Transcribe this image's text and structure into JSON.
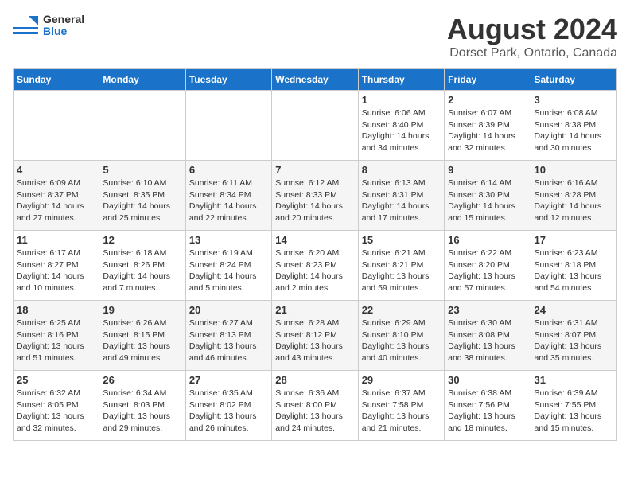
{
  "logo": {
    "line1": "General",
    "line2": "Blue"
  },
  "title": "August 2024",
  "location": "Dorset Park, Ontario, Canada",
  "days_of_week": [
    "Sunday",
    "Monday",
    "Tuesday",
    "Wednesday",
    "Thursday",
    "Friday",
    "Saturday"
  ],
  "weeks": [
    [
      {
        "day": "",
        "info": ""
      },
      {
        "day": "",
        "info": ""
      },
      {
        "day": "",
        "info": ""
      },
      {
        "day": "",
        "info": ""
      },
      {
        "day": "1",
        "info": "Sunrise: 6:06 AM\nSunset: 8:40 PM\nDaylight: 14 hours\nand 34 minutes."
      },
      {
        "day": "2",
        "info": "Sunrise: 6:07 AM\nSunset: 8:39 PM\nDaylight: 14 hours\nand 32 minutes."
      },
      {
        "day": "3",
        "info": "Sunrise: 6:08 AM\nSunset: 8:38 PM\nDaylight: 14 hours\nand 30 minutes."
      }
    ],
    [
      {
        "day": "4",
        "info": "Sunrise: 6:09 AM\nSunset: 8:37 PM\nDaylight: 14 hours\nand 27 minutes."
      },
      {
        "day": "5",
        "info": "Sunrise: 6:10 AM\nSunset: 8:35 PM\nDaylight: 14 hours\nand 25 minutes."
      },
      {
        "day": "6",
        "info": "Sunrise: 6:11 AM\nSunset: 8:34 PM\nDaylight: 14 hours\nand 22 minutes."
      },
      {
        "day": "7",
        "info": "Sunrise: 6:12 AM\nSunset: 8:33 PM\nDaylight: 14 hours\nand 20 minutes."
      },
      {
        "day": "8",
        "info": "Sunrise: 6:13 AM\nSunset: 8:31 PM\nDaylight: 14 hours\nand 17 minutes."
      },
      {
        "day": "9",
        "info": "Sunrise: 6:14 AM\nSunset: 8:30 PM\nDaylight: 14 hours\nand 15 minutes."
      },
      {
        "day": "10",
        "info": "Sunrise: 6:16 AM\nSunset: 8:28 PM\nDaylight: 14 hours\nand 12 minutes."
      }
    ],
    [
      {
        "day": "11",
        "info": "Sunrise: 6:17 AM\nSunset: 8:27 PM\nDaylight: 14 hours\nand 10 minutes."
      },
      {
        "day": "12",
        "info": "Sunrise: 6:18 AM\nSunset: 8:26 PM\nDaylight: 14 hours\nand 7 minutes."
      },
      {
        "day": "13",
        "info": "Sunrise: 6:19 AM\nSunset: 8:24 PM\nDaylight: 14 hours\nand 5 minutes."
      },
      {
        "day": "14",
        "info": "Sunrise: 6:20 AM\nSunset: 8:23 PM\nDaylight: 14 hours\nand 2 minutes."
      },
      {
        "day": "15",
        "info": "Sunrise: 6:21 AM\nSunset: 8:21 PM\nDaylight: 13 hours\nand 59 minutes."
      },
      {
        "day": "16",
        "info": "Sunrise: 6:22 AM\nSunset: 8:20 PM\nDaylight: 13 hours\nand 57 minutes."
      },
      {
        "day": "17",
        "info": "Sunrise: 6:23 AM\nSunset: 8:18 PM\nDaylight: 13 hours\nand 54 minutes."
      }
    ],
    [
      {
        "day": "18",
        "info": "Sunrise: 6:25 AM\nSunset: 8:16 PM\nDaylight: 13 hours\nand 51 minutes."
      },
      {
        "day": "19",
        "info": "Sunrise: 6:26 AM\nSunset: 8:15 PM\nDaylight: 13 hours\nand 49 minutes."
      },
      {
        "day": "20",
        "info": "Sunrise: 6:27 AM\nSunset: 8:13 PM\nDaylight: 13 hours\nand 46 minutes."
      },
      {
        "day": "21",
        "info": "Sunrise: 6:28 AM\nSunset: 8:12 PM\nDaylight: 13 hours\nand 43 minutes."
      },
      {
        "day": "22",
        "info": "Sunrise: 6:29 AM\nSunset: 8:10 PM\nDaylight: 13 hours\nand 40 minutes."
      },
      {
        "day": "23",
        "info": "Sunrise: 6:30 AM\nSunset: 8:08 PM\nDaylight: 13 hours\nand 38 minutes."
      },
      {
        "day": "24",
        "info": "Sunrise: 6:31 AM\nSunset: 8:07 PM\nDaylight: 13 hours\nand 35 minutes."
      }
    ],
    [
      {
        "day": "25",
        "info": "Sunrise: 6:32 AM\nSunset: 8:05 PM\nDaylight: 13 hours\nand 32 minutes."
      },
      {
        "day": "26",
        "info": "Sunrise: 6:34 AM\nSunset: 8:03 PM\nDaylight: 13 hours\nand 29 minutes."
      },
      {
        "day": "27",
        "info": "Sunrise: 6:35 AM\nSunset: 8:02 PM\nDaylight: 13 hours\nand 26 minutes."
      },
      {
        "day": "28",
        "info": "Sunrise: 6:36 AM\nSunset: 8:00 PM\nDaylight: 13 hours\nand 24 minutes."
      },
      {
        "day": "29",
        "info": "Sunrise: 6:37 AM\nSunset: 7:58 PM\nDaylight: 13 hours\nand 21 minutes."
      },
      {
        "day": "30",
        "info": "Sunrise: 6:38 AM\nSunset: 7:56 PM\nDaylight: 13 hours\nand 18 minutes."
      },
      {
        "day": "31",
        "info": "Sunrise: 6:39 AM\nSunset: 7:55 PM\nDaylight: 13 hours\nand 15 minutes."
      }
    ]
  ]
}
